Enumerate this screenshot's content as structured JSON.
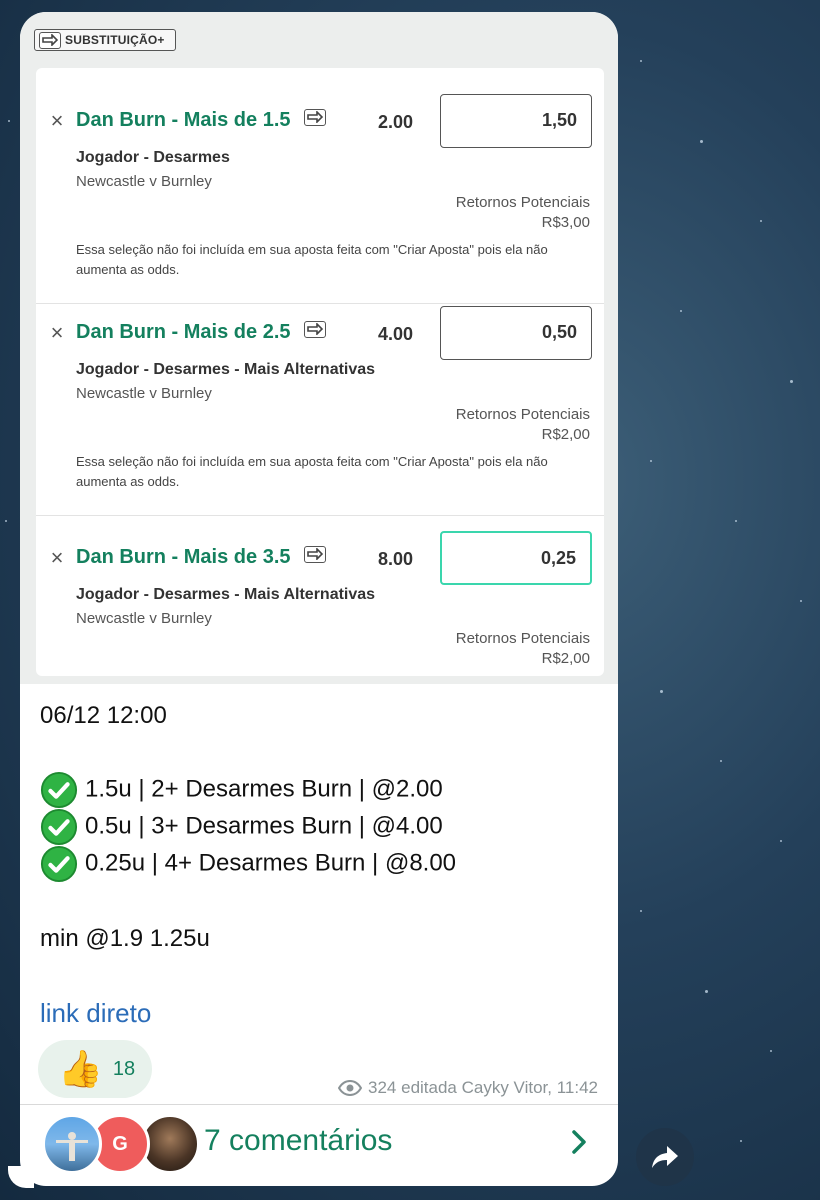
{
  "post": {
    "substitution_tag": "SUBSTITUIÇÃO+",
    "selections": [
      {
        "title": "Dan Burn - Mais de 1.5",
        "odds": "2.00",
        "stake": "1,50",
        "market": "Jogador - Desarmes",
        "event": "Newcastle v Burnley",
        "returns_label": "Retornos Potenciais",
        "returns_value": "R$3,00",
        "note": "Essa seleção não foi incluída em sua aposta feita com \"Criar Aposta\" pois ela não aumenta as odds."
      },
      {
        "title": "Dan Burn - Mais de 2.5",
        "odds": "4.00",
        "stake": "0,50",
        "market": "Jogador - Desarmes - Mais Alternativas",
        "event": "Newcastle v Burnley",
        "returns_label": "Retornos Potenciais",
        "returns_value": "R$2,00",
        "note": "Essa seleção não foi incluída em sua aposta feita com \"Criar Aposta\" pois ela não aumenta as odds."
      },
      {
        "title": "Dan Burn - Mais de 3.5",
        "odds": "8.00",
        "stake": "0,25",
        "market": "Jogador - Desarmes - Mais Alternativas",
        "event": "Newcastle v Burnley",
        "returns_label": "Retornos Potenciais",
        "returns_value": "R$2,00"
      }
    ],
    "message": {
      "datetime": "06/12 12:00",
      "lines": [
        "1.5u | 2+ Desarmes Burn | @2.00",
        "0.5u | 3+ Desarmes Burn | @4.00",
        "0.25u | 4+ Desarmes Burn | @8.00"
      ],
      "min_line": "min @1.9 1.25u",
      "link_text": "link direto"
    },
    "reaction": {
      "emoji": "👍",
      "count": "18"
    },
    "meta": {
      "views": "324",
      "edited_author_time": "editada Cayky Vitor, 11:42"
    },
    "comments": {
      "label": "7 comentários",
      "avatar_g_letter": "G"
    }
  },
  "colors": {
    "brand_green": "#14805e",
    "active_border": "#3ad6ad",
    "link_blue": "#2b6cb8",
    "check_green": "#2fb344"
  },
  "icons": [
    "swap-icon",
    "close-icon",
    "check-icon",
    "thumbs-up-icon",
    "eye-icon",
    "chevron-right-icon",
    "share-icon"
  ]
}
